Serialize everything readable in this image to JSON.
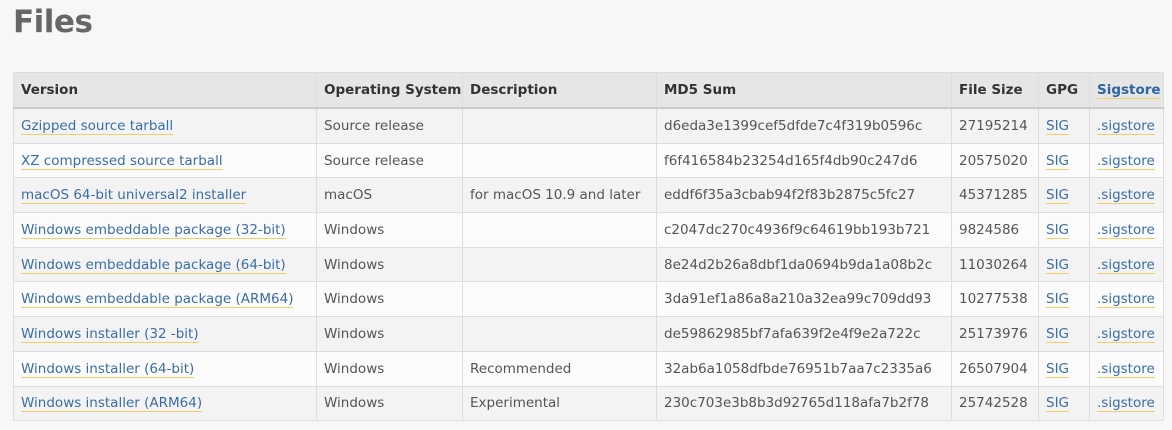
{
  "page": {
    "title": "Files"
  },
  "table": {
    "headers": {
      "version": "Version",
      "os": "Operating System",
      "description": "Description",
      "md5": "MD5 Sum",
      "size": "File Size",
      "gpg": "GPG",
      "sigstore": "Sigstore"
    },
    "rows": [
      {
        "version": "Gzipped source tarball",
        "os": "Source release",
        "description": "",
        "md5": "d6eda3e1399cef5dfde7c4f319b0596c",
        "size": "27195214",
        "gpg": "SIG",
        "sigstore": ".sigstore"
      },
      {
        "version": "XZ compressed source tarball",
        "os": "Source release",
        "description": "",
        "md5": "f6f416584b23254d165f4db90c247d6",
        "size": "20575020",
        "gpg": "SIG",
        "sigstore": ".sigstore"
      },
      {
        "version": "macOS 64-bit universal2 installer",
        "os": "macOS",
        "description": "for macOS 10.9 and later",
        "md5": "eddf6f35a3cbab94f2f83b2875c5fc27",
        "size": "45371285",
        "gpg": "SIG",
        "sigstore": ".sigstore"
      },
      {
        "version": "Windows embeddable package (32-bit)",
        "os": "Windows",
        "description": "",
        "md5": "c2047dc270c4936f9c64619bb193b721",
        "size": "9824586",
        "gpg": "SIG",
        "sigstore": ".sigstore"
      },
      {
        "version": "Windows embeddable package (64-bit)",
        "os": "Windows",
        "description": "",
        "md5": "8e24d2b26a8dbf1da0694b9da1a08b2c",
        "size": "11030264",
        "gpg": "SIG",
        "sigstore": ".sigstore"
      },
      {
        "version": "Windows embeddable package (ARM64)",
        "os": "Windows",
        "description": "",
        "md5": "3da91ef1a86a8a210a32ea99c709dd93",
        "size": "10277538",
        "gpg": "SIG",
        "sigstore": ".sigstore"
      },
      {
        "version": "Windows installer (32 -bit)",
        "os": "Windows",
        "description": "",
        "md5": "de59862985bf7afa639f2e4f9e2a722c",
        "size": "25173976",
        "gpg": "SIG",
        "sigstore": ".sigstore"
      },
      {
        "version": "Windows installer (64-bit)",
        "os": "Windows",
        "description": "Recommended",
        "md5": "32ab6a1058dfbde76951b7aa7c2335a6",
        "size": "26507904",
        "gpg": "SIG",
        "sigstore": ".sigstore"
      },
      {
        "version": "Windows installer (ARM64)",
        "os": "Windows",
        "description": "Experimental",
        "md5": "230c703e3b8b3d92765d118afa7b2f78",
        "size": "25742528",
        "gpg": "SIG",
        "sigstore": ".sigstore"
      }
    ]
  }
}
